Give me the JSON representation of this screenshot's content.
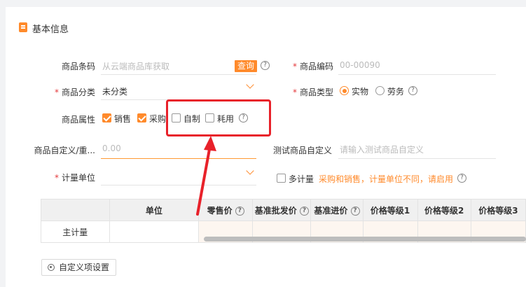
{
  "section": {
    "title": "基本信息"
  },
  "fields": {
    "barcode": {
      "label": "商品条码",
      "placeholder": "从云端商品库获取",
      "button": "查询"
    },
    "code": {
      "label": "商品编码",
      "value": "00-00090"
    },
    "category": {
      "label": "商品分类",
      "value": "未分类"
    },
    "type": {
      "label": "商品类型",
      "options": [
        "实物",
        "劳务"
      ],
      "selected": "实物"
    },
    "attributes": {
      "label": "商品属性",
      "options": [
        "销售",
        "采购",
        "自制",
        "耗用"
      ],
      "checked": [
        "销售",
        "采购"
      ]
    },
    "custom_weight": {
      "label": "商品自定义/重...",
      "value": "0.00"
    },
    "test_custom": {
      "label": "测试商品自定义",
      "placeholder": "请输入测试商品自定义"
    },
    "unit": {
      "label": "计量单位",
      "value": ""
    },
    "multi_unit": {
      "label": "多计量",
      "warning": "采购和销售，计量单位不同，请启用",
      "checked": false
    }
  },
  "table": {
    "headers": [
      "",
      "单位",
      "零售价",
      "基准批发价",
      "基准进价",
      "价格等级1",
      "价格等级2",
      "价格等级3"
    ],
    "rows": [
      [
        "主计量",
        "",
        "",
        "",
        "",
        "",
        "",
        ""
      ]
    ]
  },
  "custom_button": {
    "label": "自定义项设置"
  },
  "colors": {
    "accent": "#ff8a2b",
    "annotation": "#e8212a",
    "required": "#e4393c"
  },
  "icons": {
    "help": "help-circle-icon",
    "dropdown": "chevron-down-icon",
    "gear": "gear-icon"
  }
}
